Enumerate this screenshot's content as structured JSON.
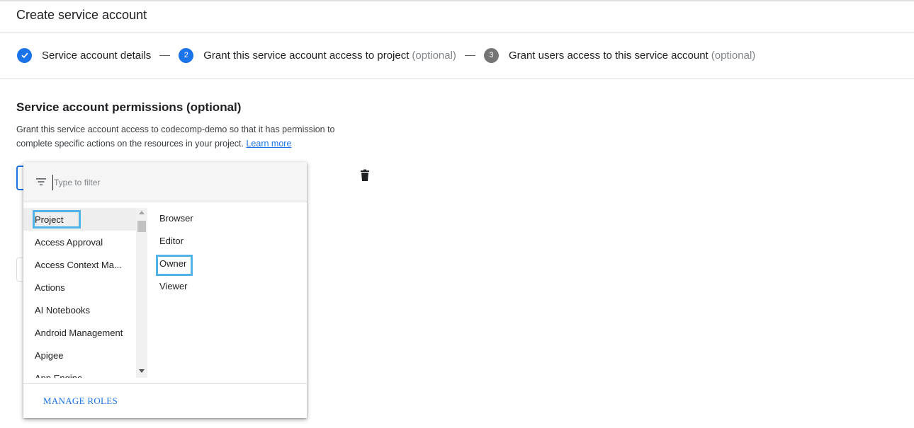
{
  "page": {
    "title": "Create service account"
  },
  "stepper": {
    "steps": [
      {
        "number": "",
        "label": "Service account details",
        "optional": "",
        "state": "done"
      },
      {
        "number": "2",
        "label": "Grant this service account access to project",
        "optional": "(optional)",
        "state": "active"
      },
      {
        "number": "3",
        "label": "Grant users access to this service account",
        "optional": "(optional)",
        "state": "pending"
      }
    ]
  },
  "section": {
    "title": "Service account permissions (optional)",
    "description": "Grant this service account access to codecomp-demo so that it has permission to complete specific actions on the resources in your project.",
    "learn_more": "Learn more"
  },
  "role_picker": {
    "filter_placeholder": "Type to filter",
    "filter_value": "",
    "categories": [
      "Project",
      "Access Approval",
      "Access Context Ma...",
      "Actions",
      "AI Notebooks",
      "Android Management",
      "Apigee",
      "App Engine"
    ],
    "selected_category": "Project",
    "roles": [
      "Browser",
      "Editor",
      "Owner",
      "Viewer"
    ],
    "highlighted_role": "Owner",
    "manage_roles": "MANAGE ROLES"
  },
  "icons": {
    "step_done": "check-circle-icon",
    "filter": "filter-list-icon",
    "delete": "trash-icon"
  },
  "colors": {
    "accent": "#1a73e8",
    "highlight_box": "#4fb3e8",
    "pending_step": "#757575"
  }
}
